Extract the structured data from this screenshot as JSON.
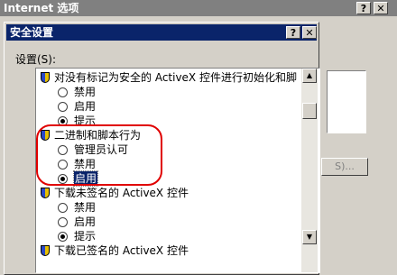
{
  "outer_window": {
    "title": "Internet 选项",
    "help_btn": "?",
    "close_btn": "✕",
    "disabled_button": "S)..."
  },
  "dialog": {
    "title": "安全设置",
    "help_btn": "?",
    "close_btn": "✕",
    "settings_label": "设置(S):"
  },
  "tree": [
    {
      "type": "group",
      "icon": "shield-icon",
      "label": "对没有标记为安全的 ActiveX 控件进行初始化和脚"
    },
    {
      "type": "option",
      "label": "禁用",
      "checked": false
    },
    {
      "type": "option",
      "label": "启用",
      "checked": false
    },
    {
      "type": "option",
      "label": "提示",
      "checked": true
    },
    {
      "type": "group",
      "icon": "shield-icon",
      "label": "二进制和脚本行为"
    },
    {
      "type": "option",
      "label": "管理员认可",
      "checked": false
    },
    {
      "type": "option",
      "label": "禁用",
      "checked": false
    },
    {
      "type": "option",
      "label": "启用",
      "checked": true,
      "selected": true
    },
    {
      "type": "group",
      "icon": "shield-icon",
      "label": "下载未签名的 ActiveX 控件"
    },
    {
      "type": "option",
      "label": "禁用",
      "checked": false
    },
    {
      "type": "option",
      "label": "启用",
      "checked": false
    },
    {
      "type": "option",
      "label": "提示",
      "checked": true
    },
    {
      "type": "group",
      "icon": "shield-icon",
      "label": "下载已签名的 ActiveX 控件"
    }
  ],
  "scrollbar": {
    "up_arrow": "▲",
    "down_arrow": "▼"
  },
  "colors": {
    "titlebar_active": "#0a246a",
    "annotation": "#e00000",
    "face": "#d4d0c8"
  }
}
